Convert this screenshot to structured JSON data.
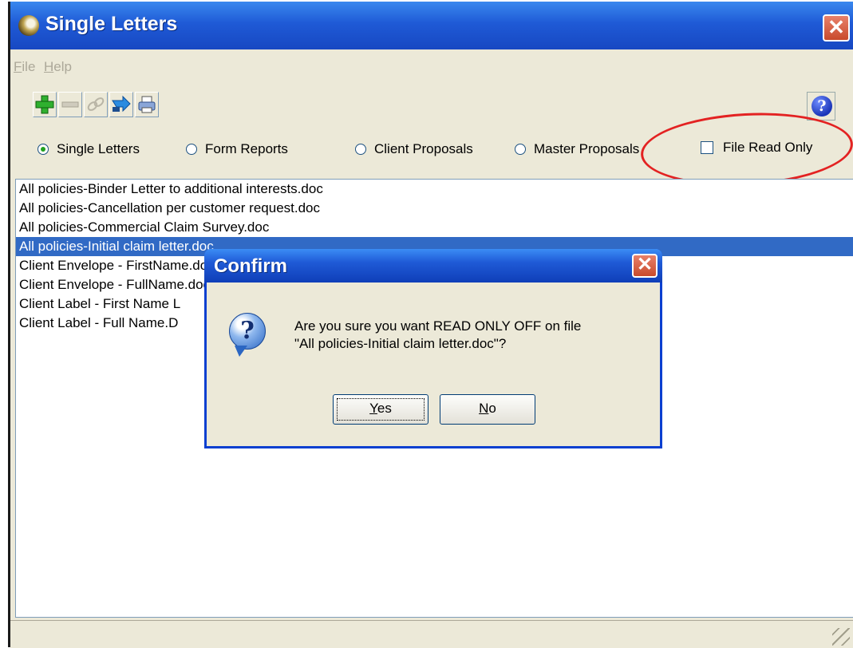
{
  "window": {
    "title": "Single Letters",
    "close_glyph": "✕"
  },
  "menu": [
    {
      "accel": "F",
      "rest": "ile"
    },
    {
      "accel": "H",
      "rest": "elp"
    }
  ],
  "toolbar": {
    "icons": [
      "add-icon",
      "remove-icon",
      "link-icon",
      "export-arrow-icon",
      "print-icon"
    ],
    "help_glyph": "?"
  },
  "document_types": {
    "options": [
      "Single Letters",
      "Form Reports",
      "Client Proposals",
      "Master Proposals"
    ],
    "selected": "Single Letters"
  },
  "read_only_checkbox": {
    "label": "File Read Only",
    "checked": false
  },
  "files": {
    "items": [
      "All policies-Binder Letter to additional interests.doc",
      "All policies-Cancellation per customer request.doc",
      "All policies-Commercial Claim Survey.doc",
      "All policies-Initial claim letter.doc",
      "Client Envelope - FirstName.doc",
      "Client Envelope - FullName.doc",
      "Client Label - First Name L",
      "Client Label - Full Name.D"
    ],
    "selected_index": 3
  },
  "confirm_dialog": {
    "title": "Confirm",
    "close_glyph": "✕",
    "icon_glyph": "?",
    "message_line1": "Are you sure you want READ ONLY OFF on file",
    "message_line2": "\"All policies-Initial claim letter.doc\"?",
    "yes": {
      "accel": "Y",
      "rest": "es"
    },
    "no": {
      "accel": "N",
      "rest": "o"
    }
  },
  "colors": {
    "title_bar": "#1f5ad6",
    "selection": "#316ac5",
    "annotation_ellipse": "#e32222"
  }
}
